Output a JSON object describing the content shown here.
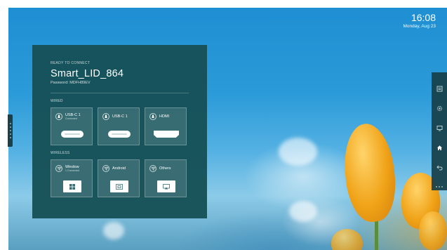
{
  "status_bar": {
    "time": "16:08",
    "date": "Monday, Aug 23"
  },
  "connect_panel": {
    "status": "READY TO CONNECT",
    "device_name": "Smart_LID_864",
    "password": "Password: MDFH89EV",
    "wired": {
      "label": "WIRED",
      "items": [
        {
          "title": "USB-C 1",
          "subtitle": "Connected",
          "icon": "usb-icon",
          "port": "usb-c-port"
        },
        {
          "title": "USB-C 1",
          "subtitle": "",
          "icon": "usb-icon",
          "port": "usb-c-port"
        },
        {
          "title": "HDMI",
          "subtitle": "",
          "icon": "usb-icon",
          "port": "hdmi-port"
        }
      ]
    },
    "wireless": {
      "label": "WIRELESS",
      "items": [
        {
          "title": "Window",
          "subtitle": "1 Connected",
          "icon": "wifi-icon",
          "device": "windows-icon"
        },
        {
          "title": "Android",
          "subtitle": "",
          "icon": "wifi-icon",
          "device": "android-cast-icon"
        },
        {
          "title": "Others",
          "subtitle": "",
          "icon": "wifi-icon",
          "device": "airplay-icon"
        }
      ]
    }
  },
  "right_sidebar": {
    "icons": [
      "panel-icon",
      "settings-icon",
      "screen-icon",
      "home-icon",
      "back-icon"
    ]
  },
  "colors": {
    "panel": "#165056",
    "sky": "#2a9ad8",
    "accent": "#ffffff"
  }
}
